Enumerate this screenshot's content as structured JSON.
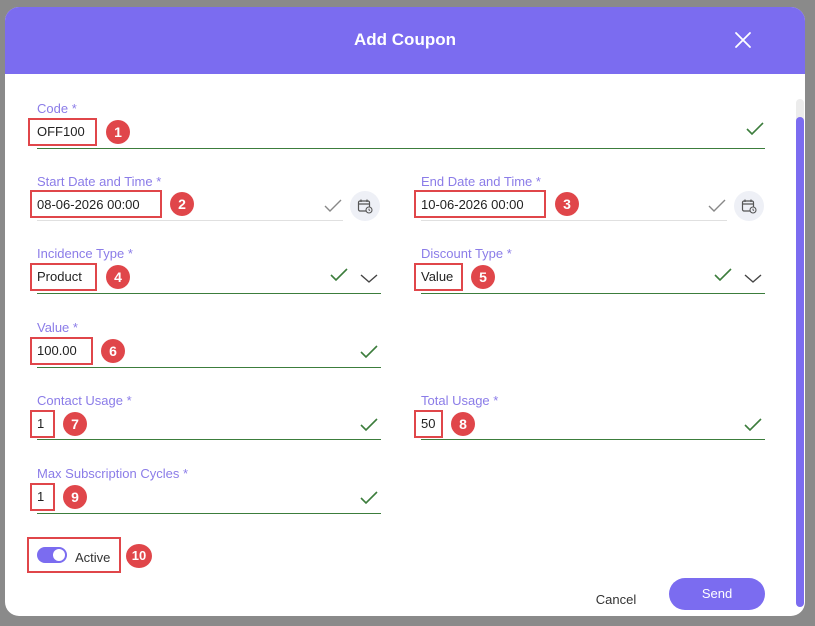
{
  "dialog": {
    "title": "Add Coupon"
  },
  "fields": {
    "code": {
      "label": "Code *",
      "value": "OFF100"
    },
    "start_date": {
      "label": "Start Date and Time *",
      "value": "08-06-2026 00:00"
    },
    "end_date": {
      "label": "End Date and Time *",
      "value": "10-06-2026 00:00"
    },
    "incidence_type": {
      "label": "Incidence Type *",
      "value": "Product"
    },
    "discount_type": {
      "label": "Discount Type *",
      "value": "Value"
    },
    "value": {
      "label": "Value *",
      "value": "100.00"
    },
    "contact_usage": {
      "label": "Contact Usage *",
      "value": "1"
    },
    "total_usage": {
      "label": "Total Usage *",
      "value": "50"
    },
    "max_cycles": {
      "label": "Max Subscription Cycles *",
      "value": "1"
    }
  },
  "toggle": {
    "label": "Active",
    "on": true
  },
  "buttons": {
    "cancel": "Cancel",
    "send": "Send"
  },
  "annotations": [
    "1",
    "2",
    "3",
    "4",
    "5",
    "6",
    "7",
    "8",
    "9",
    "10"
  ],
  "colors": {
    "accent": "#7b6cf0",
    "valid": "#3c7d3c",
    "annotation": "#e0464a"
  },
  "icons": {
    "close": "close-icon",
    "calendar": "calendar-icon",
    "check": "check-icon",
    "chevron": "chevron-down-icon"
  }
}
